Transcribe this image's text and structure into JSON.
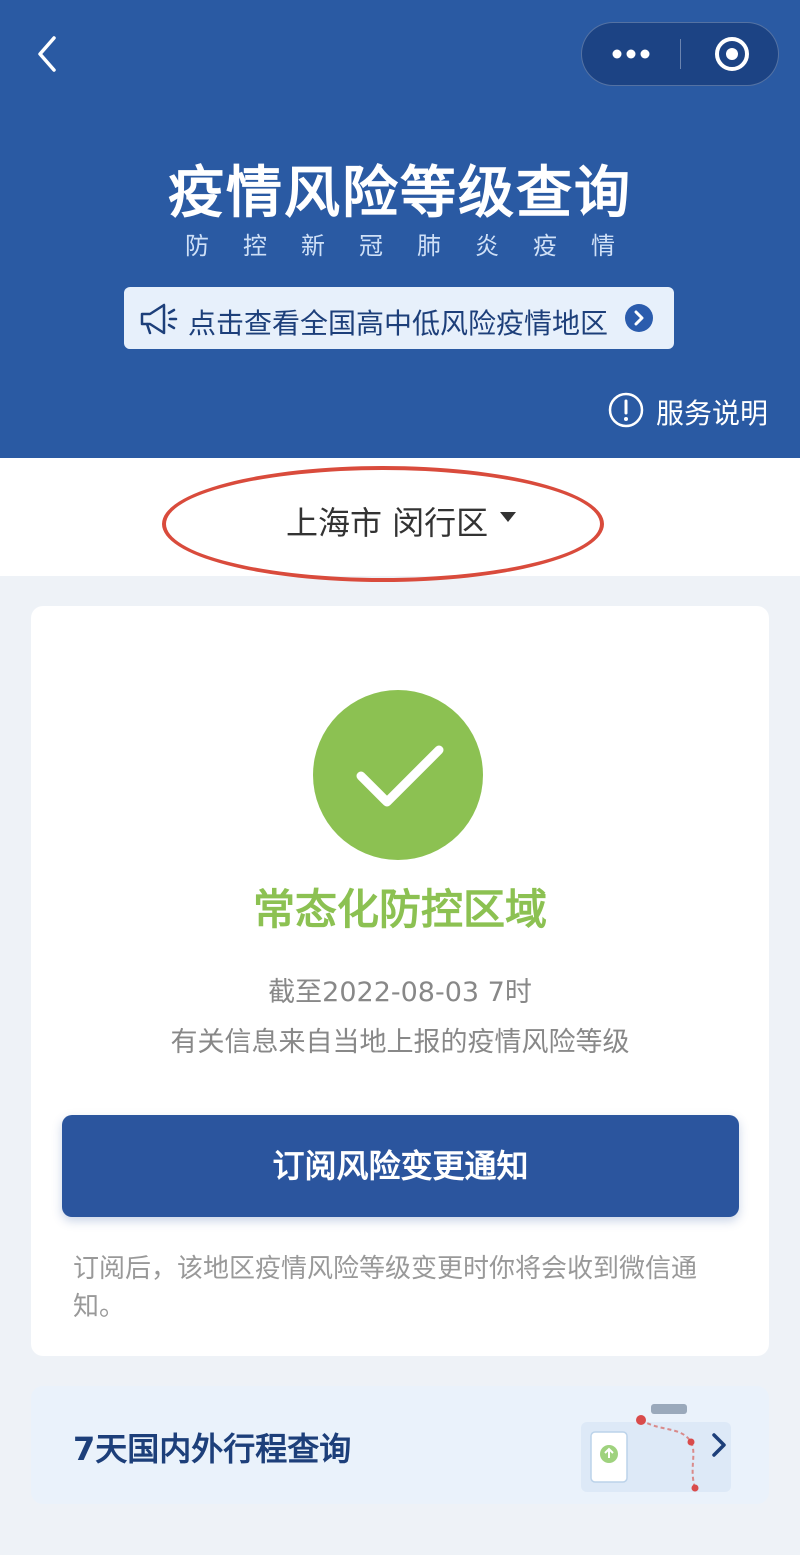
{
  "header": {
    "title": "疫情风险等级查询",
    "subtitle": "防控新冠肺炎疫情",
    "banner_text": "点击查看全国高中低风险疫情地区",
    "service_label": "服务说明",
    "icons": [
      "back-icon",
      "more-icon",
      "close-target-icon",
      "megaphone-icon",
      "arrow-right-circle-icon",
      "info-icon"
    ]
  },
  "region": {
    "label": "上海市 闵行区"
  },
  "status": {
    "level": "常态化防控区域",
    "date": "截至2022-08-03 7时",
    "source": "有关信息来自当地上报的疫情风险等级",
    "subscribe_label": "订阅风险变更通知",
    "note": "订阅后，该地区疫情风险等级变更时你将会收到微信通知。",
    "color": "#8cc152"
  },
  "travel": {
    "label": "7天国内外行程查询"
  },
  "colors": {
    "header_bg": "#2a5aa3",
    "button_bg": "#2b559e",
    "highlight": "#d94b3c"
  }
}
